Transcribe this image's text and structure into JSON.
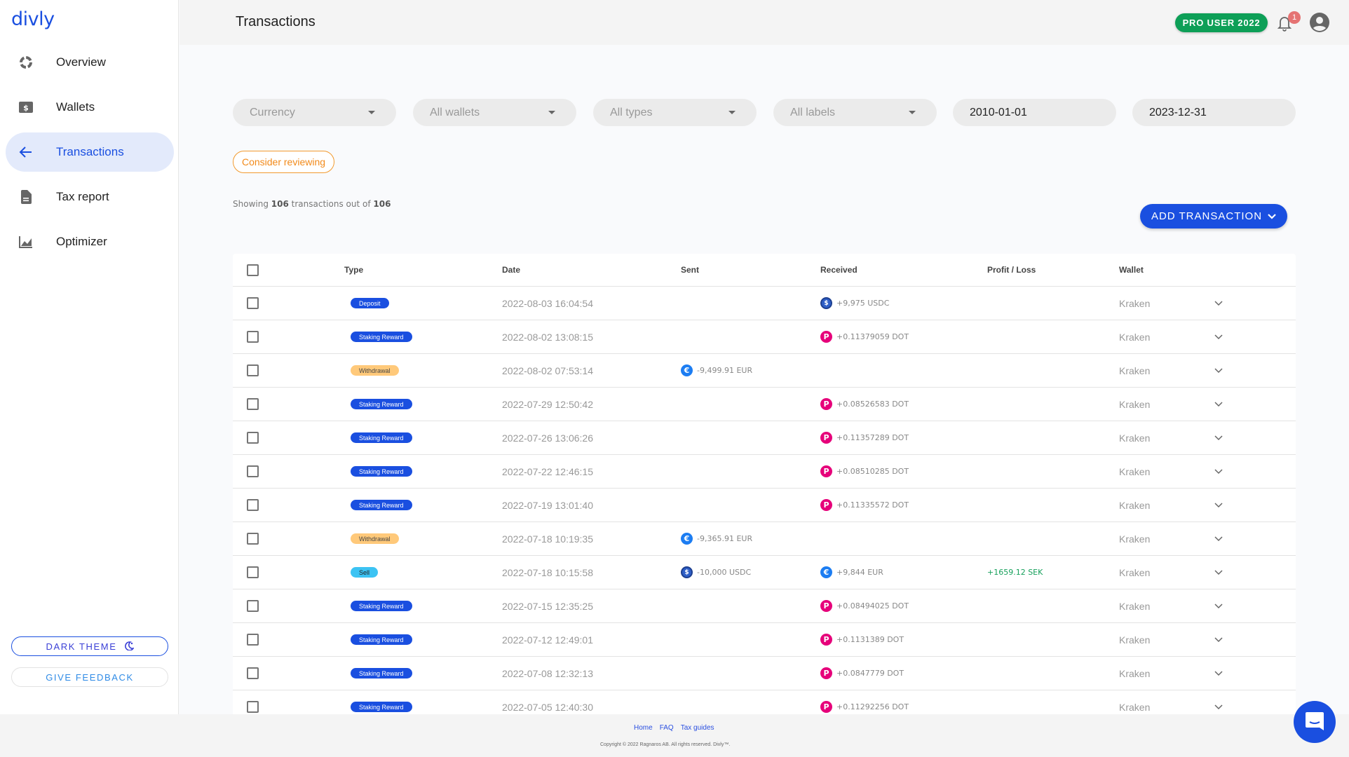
{
  "app": {
    "logo": "divly"
  },
  "sidebar": {
    "items": [
      {
        "label": "Overview",
        "icon": "donut-chart-icon",
        "active": false
      },
      {
        "label": "Wallets",
        "icon": "wallet-dollar-icon",
        "active": false
      },
      {
        "label": "Transactions",
        "icon": "arrow-left-icon",
        "active": true
      },
      {
        "label": "Tax report",
        "icon": "document-icon",
        "active": false
      },
      {
        "label": "Optimizer",
        "icon": "line-chart-icon",
        "active": false
      }
    ],
    "dark_theme_label": "DARK THEME",
    "feedback_label": "GIVE FEEDBACK"
  },
  "header": {
    "title": "Transactions",
    "pro_badge": "PRO USER 2022",
    "notification_count": "1"
  },
  "filters": {
    "currency": "Currency",
    "wallets": "All wallets",
    "types": "All types",
    "labels": "All labels",
    "date_from": "2010-01-01",
    "date_to": "2023-12-31"
  },
  "review_label": "Consider reviewing",
  "summary": {
    "prefix": "Showing",
    "shown": "106",
    "middle": "transactions out of",
    "total": "106"
  },
  "add_transaction_label": "ADD TRANSACTION",
  "table": {
    "columns": {
      "type": "Type",
      "date": "Date",
      "sent": "Sent",
      "received": "Received",
      "pl": "Profit / Loss",
      "wallet": "Wallet"
    },
    "rows": [
      {
        "type": "Deposit",
        "type_style": "blue",
        "date": "2022-08-03 16:04:54",
        "sent": "",
        "sent_coin": "",
        "received": "+9,975 USDC",
        "received_coin": "usdc",
        "pl": "",
        "wallet": "Kraken"
      },
      {
        "type": "Staking Reward",
        "type_style": "blue",
        "date": "2022-08-02 13:08:15",
        "sent": "",
        "sent_coin": "",
        "received": "+0.11379059 DOT",
        "received_coin": "dot",
        "pl": "",
        "wallet": "Kraken"
      },
      {
        "type": "Withdrawal",
        "type_style": "orange",
        "date": "2022-08-02 07:53:14",
        "sent": "-9,499.91 EUR",
        "sent_coin": "eur",
        "received": "",
        "received_coin": "",
        "pl": "",
        "wallet": "Kraken"
      },
      {
        "type": "Staking Reward",
        "type_style": "blue",
        "date": "2022-07-29 12:50:42",
        "sent": "",
        "sent_coin": "",
        "received": "+0.08526583 DOT",
        "received_coin": "dot",
        "pl": "",
        "wallet": "Kraken"
      },
      {
        "type": "Staking Reward",
        "type_style": "blue",
        "date": "2022-07-26 13:06:26",
        "sent": "",
        "sent_coin": "",
        "received": "+0.11357289 DOT",
        "received_coin": "dot",
        "pl": "",
        "wallet": "Kraken"
      },
      {
        "type": "Staking Reward",
        "type_style": "blue",
        "date": "2022-07-22 12:46:15",
        "sent": "",
        "sent_coin": "",
        "received": "+0.08510285 DOT",
        "received_coin": "dot",
        "pl": "",
        "wallet": "Kraken"
      },
      {
        "type": "Staking Reward",
        "type_style": "blue",
        "date": "2022-07-19 13:01:40",
        "sent": "",
        "sent_coin": "",
        "received": "+0.11335572 DOT",
        "received_coin": "dot",
        "pl": "",
        "wallet": "Kraken"
      },
      {
        "type": "Withdrawal",
        "type_style": "orange",
        "date": "2022-07-18 10:19:35",
        "sent": "-9,365.91 EUR",
        "sent_coin": "eur",
        "received": "",
        "received_coin": "",
        "pl": "",
        "wallet": "Kraken"
      },
      {
        "type": "Sell",
        "type_style": "cyan",
        "date": "2022-07-18 10:15:58",
        "sent": "-10,000 USDC",
        "sent_coin": "usdc",
        "received": "+9,844 EUR",
        "received_coin": "eur",
        "pl": "+1659.12 SEK",
        "wallet": "Kraken"
      },
      {
        "type": "Staking Reward",
        "type_style": "blue",
        "date": "2022-07-15 12:35:25",
        "sent": "",
        "sent_coin": "",
        "received": "+0.08494025 DOT",
        "received_coin": "dot",
        "pl": "",
        "wallet": "Kraken"
      },
      {
        "type": "Staking Reward",
        "type_style": "blue",
        "date": "2022-07-12 12:49:01",
        "sent": "",
        "sent_coin": "",
        "received": "+0.1131389 DOT",
        "received_coin": "dot",
        "pl": "",
        "wallet": "Kraken"
      },
      {
        "type": "Staking Reward",
        "type_style": "blue",
        "date": "2022-07-08 12:32:13",
        "sent": "",
        "sent_coin": "",
        "received": "+0.0847779 DOT",
        "received_coin": "dot",
        "pl": "",
        "wallet": "Kraken"
      },
      {
        "type": "Staking Reward",
        "type_style": "blue",
        "date": "2022-07-05 12:40:30",
        "sent": "",
        "sent_coin": "",
        "received": "+0.11292256 DOT",
        "received_coin": "dot",
        "pl": "",
        "wallet": "Kraken"
      }
    ]
  },
  "coins": {
    "dot": {
      "glyph": "P",
      "color": "#e6007a"
    },
    "eur": {
      "glyph": "€",
      "color": "#1c7df2"
    },
    "usdc": {
      "glyph": "$",
      "color": "#2f5fc7"
    }
  },
  "colors": {
    "accent": "#1a4fe0",
    "pro": "#0d9f57",
    "warning": "#f28a1a",
    "profit": "#16a05b"
  },
  "footer": {
    "links": [
      "Home",
      "FAQ",
      "Tax guides"
    ],
    "copyright": "Copyright © 2022 Ragnaros AB. All rights reserved. Divly™."
  }
}
